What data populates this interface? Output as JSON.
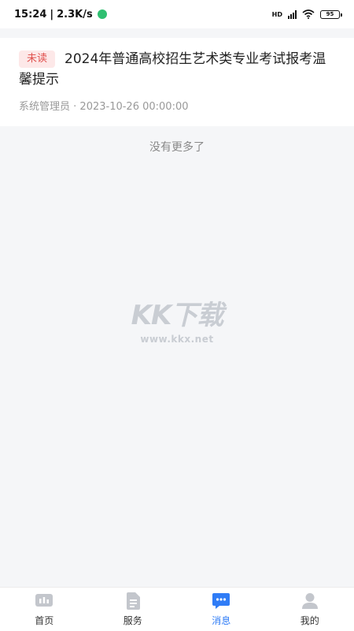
{
  "status_bar": {
    "time": "15:24",
    "speed": "2.3K/s",
    "network": "HD",
    "battery": "95"
  },
  "message": {
    "badge": "未读",
    "title": "2024年普通高校招生艺术类专业考试报考温馨提示",
    "sender": "系统管理员",
    "date": "2023-10-26 00:00:00"
  },
  "list_footer": "没有更多了",
  "watermark": {
    "logo": "KK下载",
    "url": "www.kkx.net"
  },
  "tabs": [
    {
      "label": "首页",
      "icon": "home-icon",
      "active": false
    },
    {
      "label": "服务",
      "icon": "document-icon",
      "active": false
    },
    {
      "label": "消息",
      "icon": "message-icon",
      "active": true
    },
    {
      "label": "我的",
      "icon": "user-icon",
      "active": false
    }
  ],
  "colors": {
    "accent": "#2f7cf6",
    "badge_bg": "#fde8e8",
    "badge_text": "#e0514e",
    "icon_inactive": "#c3c6cc"
  }
}
